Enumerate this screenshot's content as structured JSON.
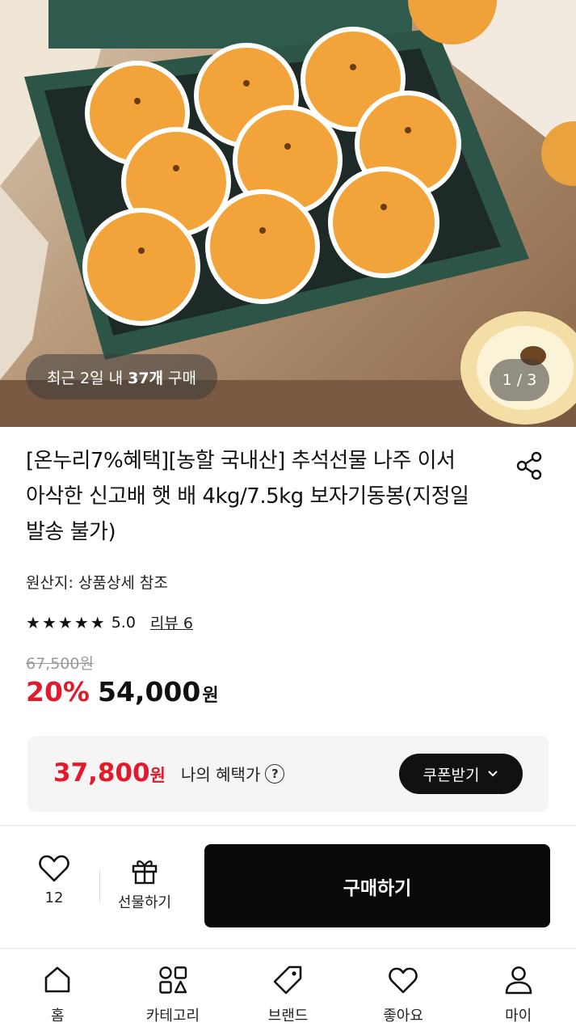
{
  "hero": {
    "recent_prefix": "최근 2일 내",
    "recent_count": "37개",
    "recent_suffix": "구매",
    "page_current": "1",
    "page_sep": "/",
    "page_total": "3"
  },
  "product": {
    "title": "[온누리7%혜택][농할 국내산] 추석선물 나주 이서 아삭한 신고배 햇 배 4kg/7.5kg 보자기동봉(지정일발송 불가)",
    "origin": "원산지: 상품상세 참조",
    "rating": "5.0",
    "review_link": "리뷰 6",
    "original_price": "67,500원",
    "discount": "20%",
    "price": "54,000",
    "price_unit": "원"
  },
  "benefit": {
    "price": "37,800",
    "unit": "원",
    "label": "나의 혜택가",
    "help_icon_glyph": "?",
    "coupon_button": "쿠폰받기"
  },
  "purchase_bar": {
    "like_count": "12",
    "gift_label": "선물하기",
    "buy_label": "구매하기"
  },
  "bottom_nav": {
    "items": [
      {
        "label": "홈",
        "icon": "home-icon"
      },
      {
        "label": "카테고리",
        "icon": "category-icon"
      },
      {
        "label": "브랜드",
        "icon": "tag-icon"
      },
      {
        "label": "좋아요",
        "icon": "heart-icon"
      },
      {
        "label": "마이",
        "icon": "user-icon"
      }
    ]
  },
  "colors": {
    "accent_red": "#e11a2c",
    "buy_button": "#0a0a0a",
    "benefit_bg": "#f5f5f5"
  }
}
